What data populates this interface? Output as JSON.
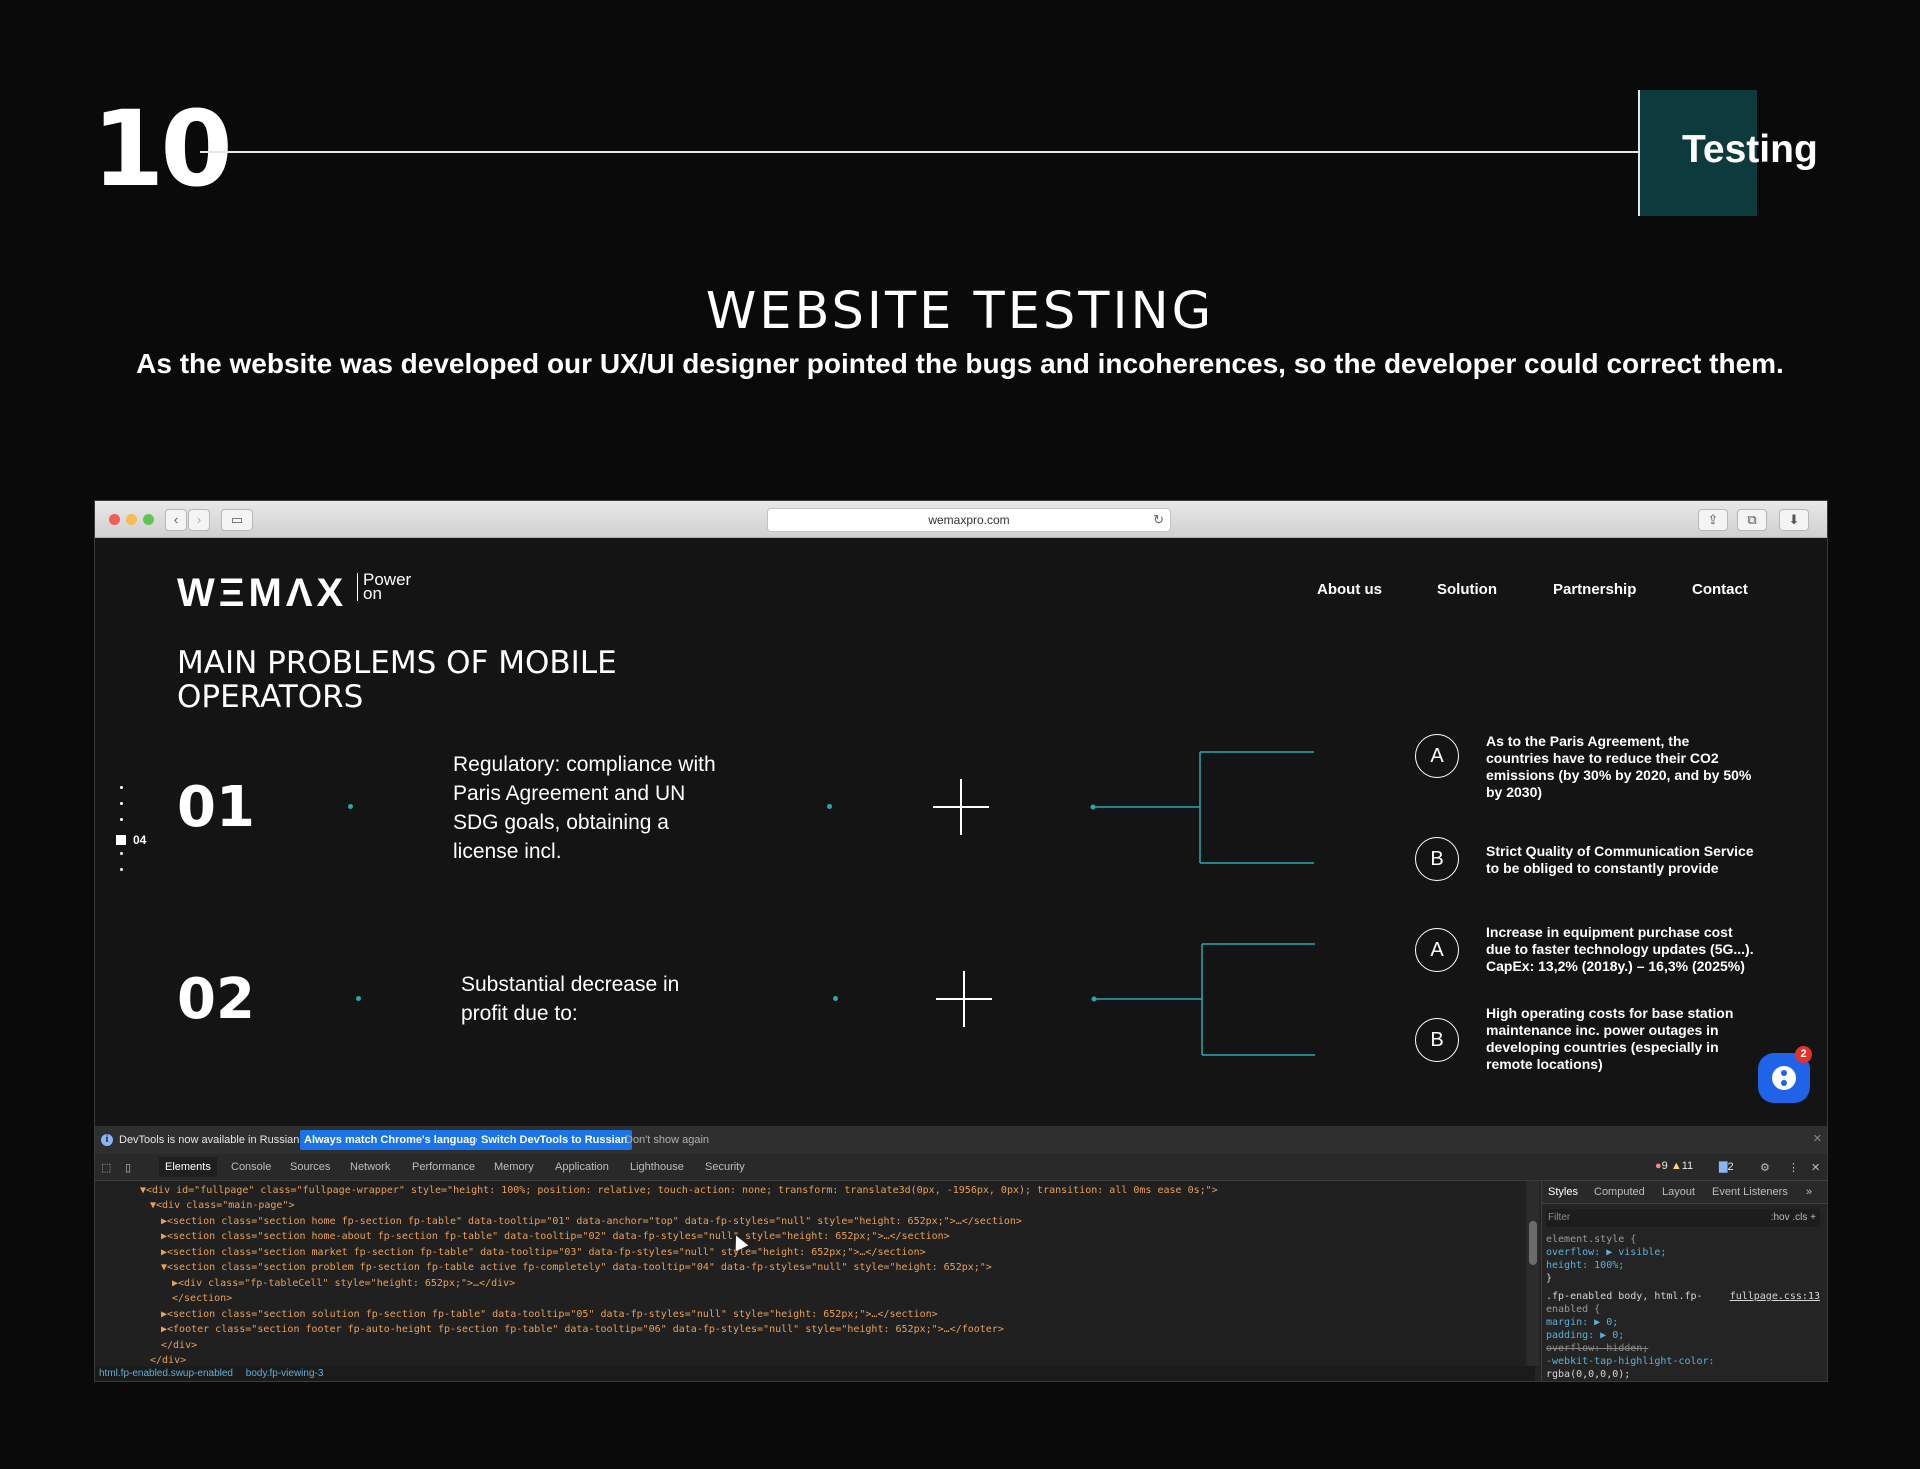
{
  "slide": {
    "number": "10",
    "section_tag": "Testing",
    "title": "WEBSITE TESTING",
    "description": "As the website was developed our UX/UI designer pointed the bugs and incoherences, so the developer could correct them."
  },
  "browser": {
    "url": "wemaxpro.com"
  },
  "site": {
    "logo": "WΞMΛX",
    "logo_tagline_1": "Power",
    "logo_tagline_2": "on",
    "nav": [
      "About us",
      "Solution",
      "Partnership",
      "Contact"
    ],
    "heading_line1": "MAIN PROBLEMS OF MOBILE",
    "heading_line2": "OPERATORS",
    "pager_label": "04",
    "problems": [
      {
        "number": "01",
        "text": "Regulatory: compliance with Paris Agreement and UN SDG goals, obtaining a license incl.",
        "points": [
          {
            "letter": "A",
            "text": "As to the Paris Agreement, the countries have to reduce their CO2 emissions (by 30% by 2020, and by 50% by 2030)"
          },
          {
            "letter": "B",
            "text": "Strict Quality of Communication Service to be obliged to constantly provide"
          }
        ]
      },
      {
        "number": "02",
        "text": "Substantial decrease in profit due to:",
        "points": [
          {
            "letter": "A",
            "text": "Increase in equipment purchase cost due to faster technology updates (5G...). CapEx: 13,2% (2018y.) – 16,3% (2025%)"
          },
          {
            "letter": "B",
            "text": "High operating costs for base station maintenance inc. power outages in developing countries (especially in remote locations)"
          }
        ]
      }
    ],
    "chat_badge": "2",
    "colors": {
      "accent": "#2aa6b0",
      "chat": "#1e63e8"
    }
  },
  "devtools": {
    "info_text": "DevTools is now available in Russian!",
    "btn_match": "Always match Chrome's language",
    "btn_switch": "Switch DevTools to Russian",
    "dismiss": "Don't show again",
    "tabs": [
      "Elements",
      "Console",
      "Sources",
      "Network",
      "Performance",
      "Memory",
      "Application",
      "Lighthouse",
      "Security"
    ],
    "errors": "9",
    "warnings": "11",
    "messages": "2",
    "code_lines": [
      "▼<div id=\"fullpage\" class=\"fullpage-wrapper\" style=\"height: 100%; position: relative; touch-action: none; transform: translate3d(0px, -1956px, 0px); transition: all 0ms ease 0s;\">",
      "▼<div class=\"main-page\">",
      "▶<section class=\"section home fp-section fp-table\" data-tooltip=\"01\" data-anchor=\"top\" data-fp-styles=\"null\" style=\"height: 652px;\">…</section>",
      "▶<section class=\"section home-about fp-section fp-table\" data-tooltip=\"02\" data-fp-styles=\"null\" style=\"height: 652px;\">…</section>",
      "▶<section class=\"section market fp-section fp-table\" data-tooltip=\"03\" data-fp-styles=\"null\" style=\"height: 652px;\">…</section>",
      "▼<section class=\"section problem fp-section fp-table active fp-completely\" data-tooltip=\"04\" data-fp-styles=\"null\" style=\"height: 652px;\">",
      "▶<div class=\"fp-tableCell\" style=\"height: 652px;\">…</div>",
      "</section>",
      "▶<section class=\"section solution fp-section fp-table\" data-tooltip=\"05\" data-fp-styles=\"null\" style=\"height: 652px;\">…</section>",
      "▶<footer class=\"section footer fp-auto-height fp-section fp-table\" data-tooltip=\"06\" data-fp-styles=\"null\" style=\"height: 652px;\">…</footer>",
      "</div>",
      "</div>"
    ],
    "breadcrumb_1": "html.fp-enabled.swup-enabled",
    "breadcrumb_2": "body.fp-viewing-3",
    "styles_tabs": [
      "Styles",
      "Computed",
      "Layout",
      "Event Listeners"
    ],
    "filter_placeholder": "Filter",
    "filter_tools": ":hov  .cls  +",
    "styles_lines": [
      "element.style {",
      "  overflow: ▶ visible;",
      "  height: 100%;",
      "}",
      ".fp-enabled body, html.fp-",
      "enabled {",
      "  margin: ▶ 0;",
      "  padding: ▶ 0;",
      "  overflow: hidden;",
      "  -webkit-tap-highlight-color:",
      "    rgba(0,0,0,0);"
    ],
    "styles_source": "fullpage.css:13"
  }
}
